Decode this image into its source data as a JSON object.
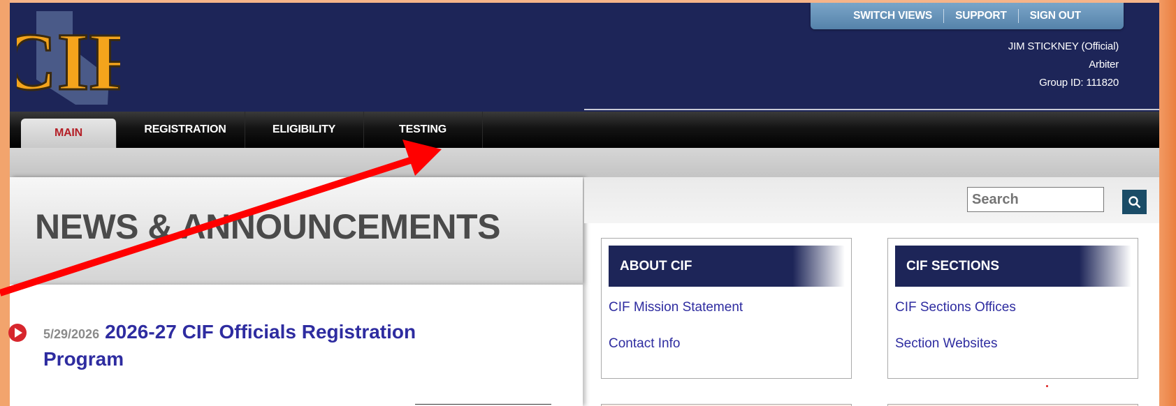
{
  "header": {
    "utility_links": [
      "SWITCH VIEWS",
      "SUPPORT",
      "SIGN OUT"
    ],
    "user_name": "JIM STICKNEY (Official)",
    "user_role": "Arbiter",
    "group_id": "Group ID: 111820"
  },
  "nav": {
    "tabs": [
      "MAIN",
      "REGISTRATION",
      "ELIGIBILITY",
      "TESTING"
    ],
    "active": "MAIN"
  },
  "news": {
    "heading": "NEWS & ANNOUNCEMENTS",
    "items": [
      {
        "date": "5/29/2026",
        "title": "2026-27 CIF Officials Registration Program"
      }
    ]
  },
  "search": {
    "placeholder": "Search"
  },
  "boxes": {
    "about": {
      "title": "ABOUT CIF",
      "links": [
        "CIF Mission Statement",
        "Contact Info"
      ]
    },
    "sections": {
      "title": "CIF SECTIONS",
      "links": [
        "CIF Sections Offices",
        "Section Websites"
      ]
    }
  },
  "colors": {
    "navy": "#1d2558",
    "accent_red": "#b41f27",
    "link": "#2e2ca0",
    "annotation_arrow": "#ff0000"
  },
  "icons": [
    "cif-logo",
    "search-icon",
    "play-circle-icon",
    "annotation-arrow"
  ]
}
